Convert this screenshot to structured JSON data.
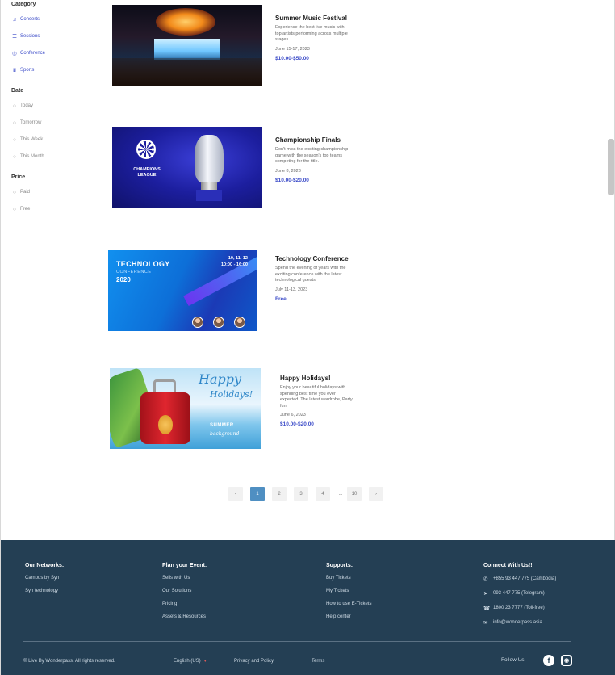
{
  "sidebar": {
    "category": {
      "title": "Category",
      "items": [
        {
          "label": "Concerts",
          "icon": "music-icon"
        },
        {
          "label": "Sessions",
          "icon": "chat-icon"
        },
        {
          "label": "Conference",
          "icon": "globe-icon"
        },
        {
          "label": "Sports",
          "icon": "trophy-icon"
        }
      ]
    },
    "date": {
      "title": "Date",
      "items": [
        "Today",
        "Tomorrow",
        "This Week",
        "This Month"
      ]
    },
    "price": {
      "title": "Price",
      "items": [
        "Paid",
        "Free"
      ]
    }
  },
  "events": [
    {
      "title": "Summer Music Festival",
      "desc": "Experience the best live music with top artists performing across multiple stages.",
      "date": "June 15-17, 2023",
      "price": "$10.00-$50.00"
    },
    {
      "title": "Championship Finals",
      "desc": "Don't miss the exciting championship game with the season's top teams competing for the title.",
      "date": "June 8, 2023",
      "price": "$10.00-$20.00"
    },
    {
      "title": "Technology Conference",
      "desc": "Spend the evening of years with the exciting conference with the latest technological guests.",
      "date": "July 11-13, 2023",
      "price": "Free",
      "banner": {
        "line1": "TECHNOLOGY",
        "line2": "CONFERENCE",
        "line3": "2020",
        "dates": "10, 11, 12",
        "time": "10:00 - 16:00"
      }
    },
    {
      "title": "Happy Holidays!",
      "desc": "Enjoy your beautiful holidays with spending best time you ever expected. The latest wardrobe, Party fun.",
      "date": "June 6, 2023",
      "price": "$10.00-$20.00",
      "banner": {
        "line1": "Happy",
        "line2": "Holidays!",
        "line3": "SUMMER",
        "line4": "background"
      }
    }
  ],
  "pagination": {
    "prev": "‹",
    "pages": [
      "1",
      "2",
      "3",
      "4"
    ],
    "ellipsis": "...",
    "last": "10",
    "next": "›",
    "active": 1
  },
  "footer": {
    "networks": {
      "title": "Our Networks:",
      "items": [
        "Campus by Syn",
        "Syn technology"
      ]
    },
    "plan": {
      "title": "Plan your Event:",
      "items": [
        "Sells with Us",
        "Our Solutions",
        "Pricing",
        "Assets & Resources"
      ]
    },
    "supports": {
      "title": "Supports:",
      "items": [
        "Buy Tickets",
        "My Tickets",
        "How to use E-Tickets",
        "Help center"
      ]
    },
    "connect": {
      "title": "Connect With Us!!",
      "items": [
        {
          "icon": "phone-icon",
          "text": "+855 93 447 775 (Cambodia)"
        },
        {
          "icon": "telegram-icon",
          "text": "093 447 775 (Telegram)"
        },
        {
          "icon": "hotline-icon",
          "text": "1800 23 7777 (Toll-free)"
        },
        {
          "icon": "mail-icon",
          "text": "info@wonderpass.asia"
        }
      ]
    },
    "copyright": "© Live By Wonderpass. All rights reserved.",
    "language": "English (US)",
    "privacy": "Privacy and Policy",
    "terms": "Terms",
    "follow": "Follow Us:"
  }
}
